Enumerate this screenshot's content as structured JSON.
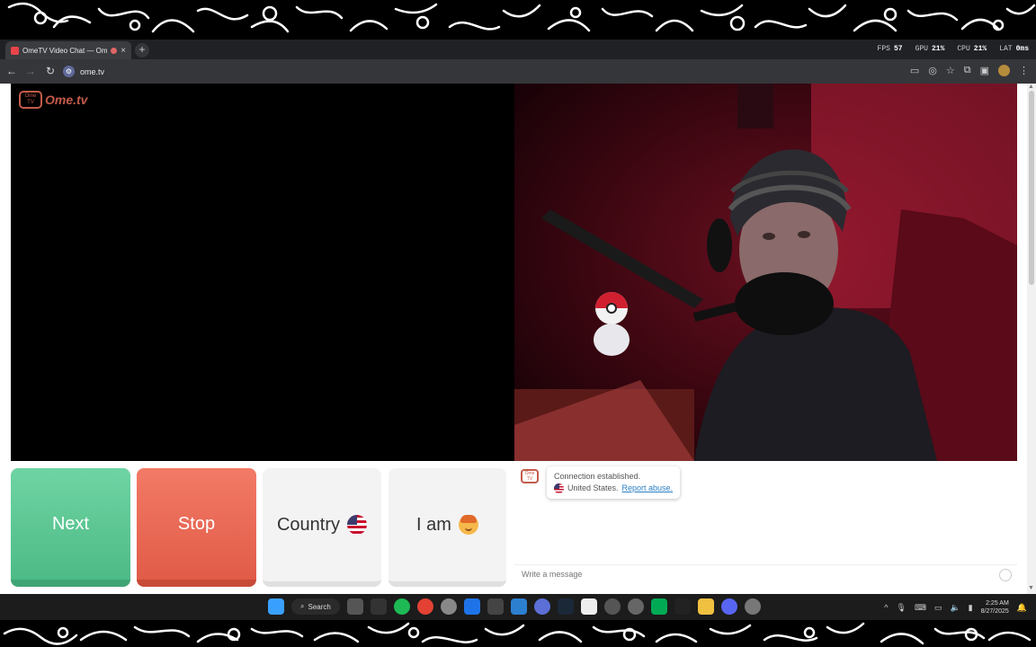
{
  "browser": {
    "tab_title": "OmeTV Video Chat — Ome",
    "tab_close": "×",
    "new_tab": "+",
    "url": "ome.tv"
  },
  "overlay": {
    "fps_label": "FPS",
    "fps_value": "57",
    "gpu_label": "GPU",
    "gpu_value": "21%",
    "cpu_label": "CPU",
    "cpu_value": "21%",
    "lat_label": "LAT",
    "lat_value": "0ms"
  },
  "site": {
    "logo_text": "Ome.tv",
    "logo_badge": "Ome TV"
  },
  "controls": {
    "next_label": "Next",
    "stop_label": "Stop",
    "country_label": "Country",
    "iam_label": "I am"
  },
  "chat": {
    "status": "Connection established.",
    "country": "United States.",
    "report": "Report abuse.",
    "input_placeholder": "Write a message"
  },
  "taskbar": {
    "search_label": "Search",
    "time": "2:25 AM",
    "date": "8/27/2025"
  },
  "colors": {
    "next": "#5cc896",
    "stop": "#e86c57",
    "brand": "#c45b4a"
  }
}
